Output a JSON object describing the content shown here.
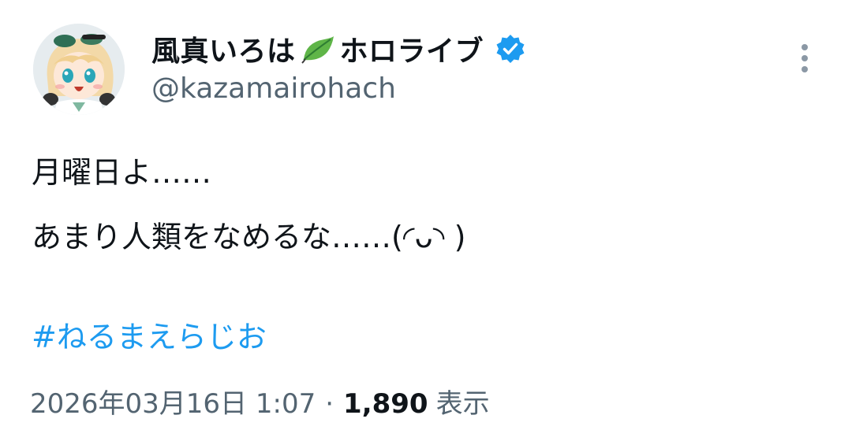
{
  "author": {
    "display_name": "風真いろは",
    "org_name": "ホロライブ",
    "handle": "@kazamairohach",
    "verified": true,
    "avatar_icon": "character-avatar",
    "badge_icon": "verified-badge-icon",
    "name_emoji": "leaf-icon"
  },
  "tweet": {
    "lines": [
      "月曜日よ……",
      "あまり人類をなめるな……(◜ᴗ◝ )"
    ],
    "hashtag": "#ねるまえらじお",
    "date": "2026年03月16日 1:07",
    "separator": "·",
    "views_count": "1,890",
    "views_label": "表示"
  },
  "colors": {
    "text": "#0f1419",
    "secondary": "#536471",
    "link": "#1d9bf0",
    "verified": "#1d9bf0",
    "leaf": "#4caf50"
  }
}
